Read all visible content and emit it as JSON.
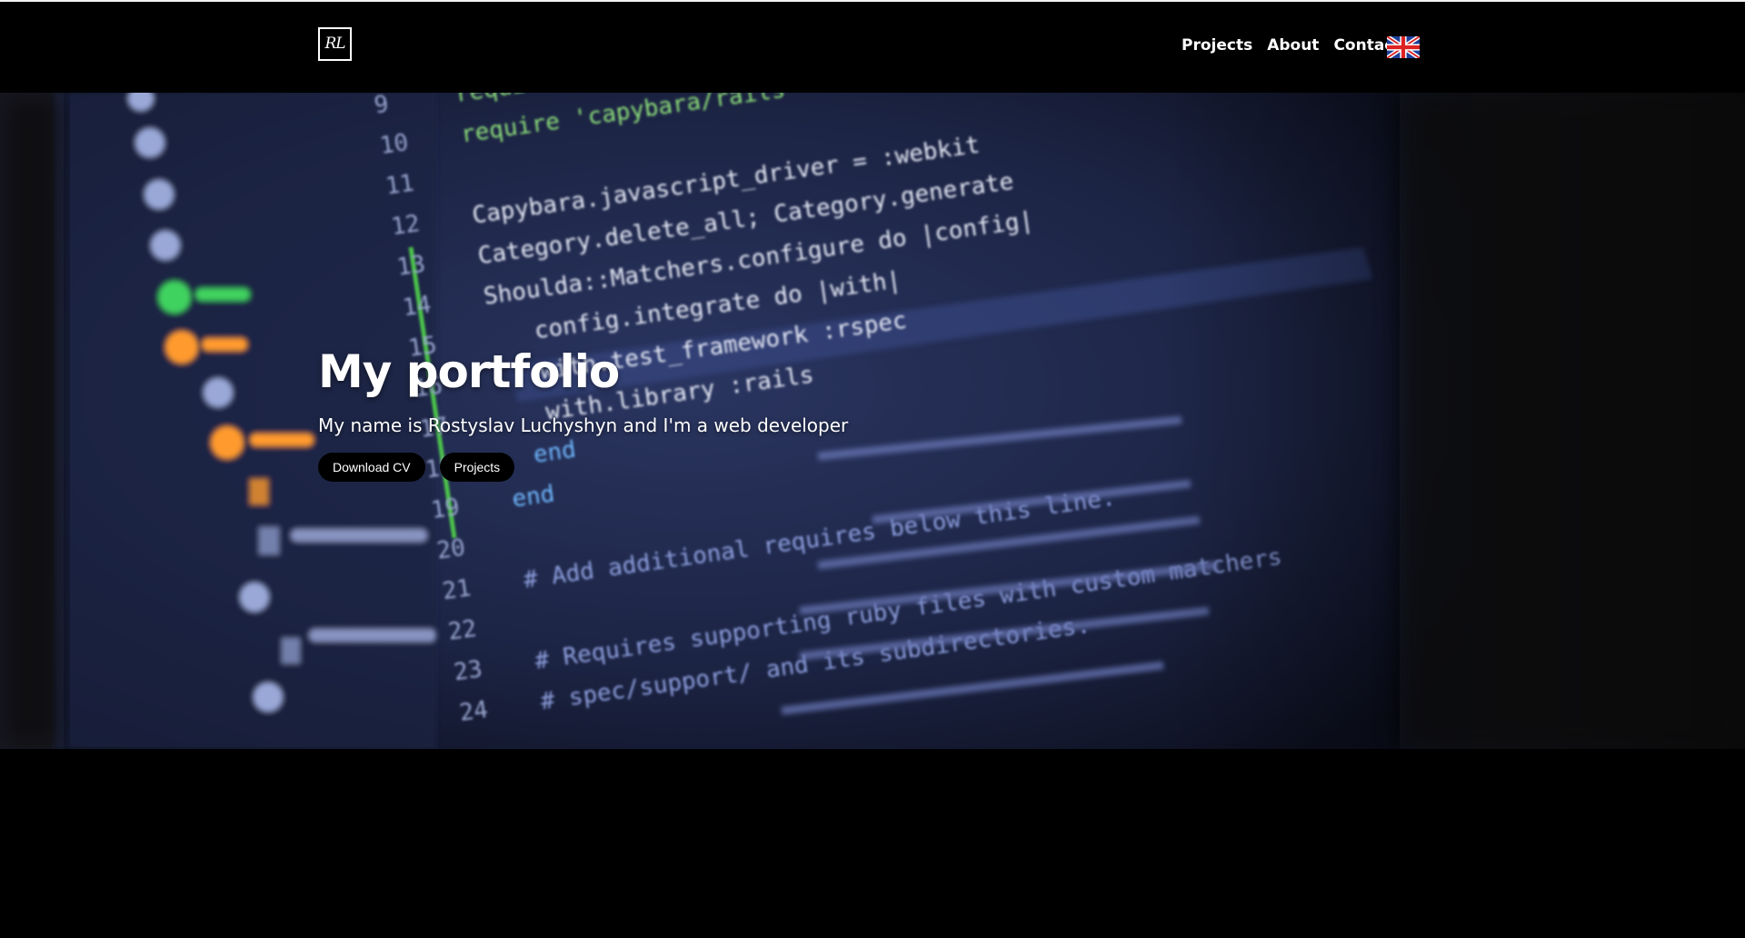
{
  "header": {
    "logo_text": "RL",
    "nav": [
      {
        "label": "Projects"
      },
      {
        "label": "About"
      },
      {
        "label": "Contact"
      }
    ],
    "language_icon": "uk-flag-icon"
  },
  "hero": {
    "title": "My portfolio",
    "subtitle": "My name is Rostyslav Luchyshyn and I'm a web developer",
    "buttons": {
      "download_cv": "Download CV",
      "projects": "Projects"
    },
    "background_code": [
      {
        "line": "9",
        "code": "require 'capybara/rspec'"
      },
      {
        "line": "10",
        "code": "require 'capybara/rails'"
      },
      {
        "line": "11",
        "code": ""
      },
      {
        "line": "12",
        "code": "Capybara.javascript_driver = :webkit"
      },
      {
        "line": "13",
        "code": "Category.delete_all; Category.generate"
      },
      {
        "line": "14",
        "code": "Shoulda::Matchers.configure do |config|"
      },
      {
        "line": "15",
        "code": "config.integrate do |with|"
      },
      {
        "line": "16",
        "code": "with.test_framework :rspec"
      },
      {
        "line": "17",
        "code": "with.library :rails"
      },
      {
        "line": "18",
        "code": "end"
      },
      {
        "line": "19",
        "code": "end"
      },
      {
        "line": "20",
        "code": ""
      },
      {
        "line": "21",
        "code": "# Add additional requires below this line."
      },
      {
        "line": "22",
        "code": ""
      },
      {
        "line": "23",
        "code": "# Requires supporting ruby files with custom matchers"
      },
      {
        "line": "24",
        "code": "# spec/support/ and its subdirectories."
      }
    ]
  },
  "colors": {
    "background": "#000000",
    "code_bg": "#1e2748",
    "code_text": "#e8ecf8",
    "code_green": "#8ee07a",
    "code_blue": "#6fb7ff",
    "gutter_green": "#4cc24c"
  }
}
